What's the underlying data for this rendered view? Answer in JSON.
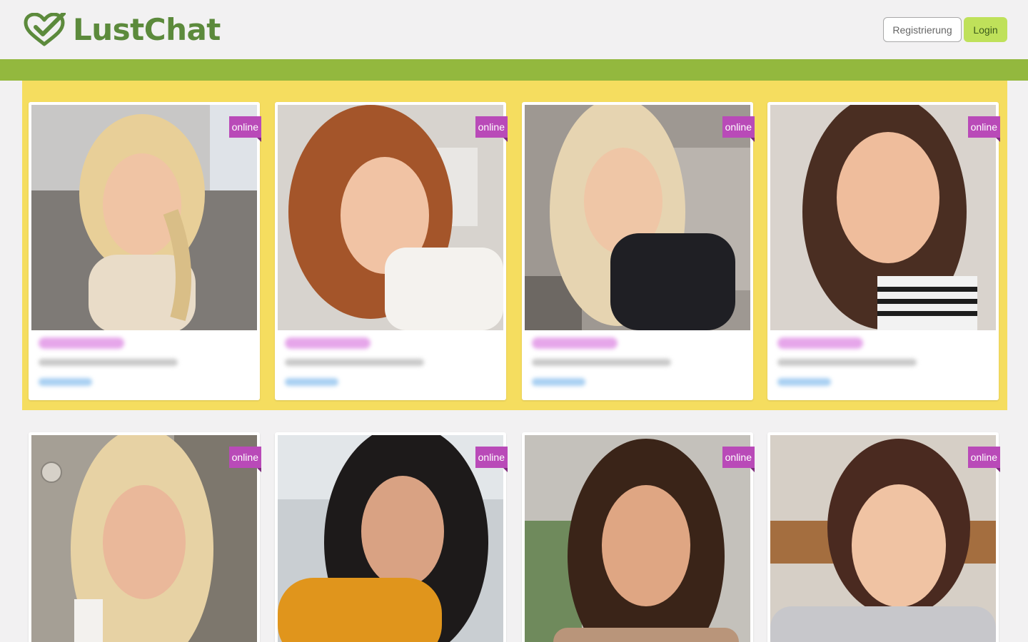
{
  "header": {
    "logo_text": "LustChat",
    "register_label": "Registrierung",
    "login_label": "Login"
  },
  "colors": {
    "brand_green": "#5c8a3c",
    "bar_green": "#93b83e",
    "featured_yellow": "#f5dd5f",
    "online_badge": "#b94ab8",
    "login_button": "#bfe15a"
  },
  "featured_profiles": [
    {
      "status": "online",
      "hair": "blonde"
    },
    {
      "status": "online",
      "hair": "auburn"
    },
    {
      "status": "online",
      "hair": "blonde"
    },
    {
      "status": "online",
      "hair": "dark-brown"
    }
  ],
  "profiles": [
    {
      "status": "online",
      "hair": "blonde"
    },
    {
      "status": "online",
      "hair": "black"
    },
    {
      "status": "online",
      "hair": "dark-brown"
    },
    {
      "status": "online",
      "hair": "brown"
    }
  ]
}
